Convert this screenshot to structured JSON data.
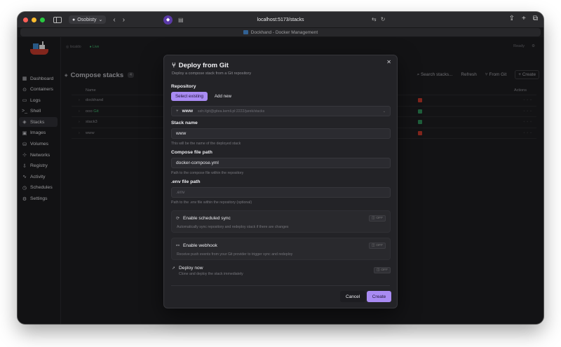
{
  "browser": {
    "profile": "Osobisty",
    "url": "localhost:5173/stacks",
    "tab_title": "Dockhand - Docker Management"
  },
  "sidebar": {
    "items": [
      {
        "label": "Dashboard",
        "icon": "dashboard-icon"
      },
      {
        "label": "Containers",
        "icon": "containers-icon"
      },
      {
        "label": "Logs",
        "icon": "logs-icon"
      },
      {
        "label": "Shell",
        "icon": "shell-icon"
      },
      {
        "label": "Stacks",
        "icon": "stacks-icon",
        "active": true
      },
      {
        "label": "Images",
        "icon": "images-icon"
      },
      {
        "label": "Volumes",
        "icon": "volumes-icon"
      },
      {
        "label": "Networks",
        "icon": "networks-icon"
      },
      {
        "label": "Registry",
        "icon": "registry-icon"
      },
      {
        "label": "Activity",
        "icon": "activity-icon"
      },
      {
        "label": "Schedules",
        "icon": "schedules-icon"
      },
      {
        "label": "Settings",
        "icon": "settings-icon"
      }
    ]
  },
  "statusbar": {
    "host": "localdo",
    "live": "Live",
    "ready": "Ready"
  },
  "page": {
    "title": "Compose stacks",
    "search_placeholder": "Search stacks...",
    "refresh": "Refresh",
    "from_git": "From Git",
    "create": "Create"
  },
  "table": {
    "headers": {
      "name": "Name",
      "actions": "Actions"
    },
    "rows": [
      {
        "name": "dockhand",
        "status_color": "#c0392b"
      },
      {
        "name": "ooo",
        "tag": "Git",
        "status_color": "#2e8b57"
      },
      {
        "name": "stack3",
        "status_color": "#2e8b57"
      },
      {
        "name": "www",
        "status_color": "#c0392b"
      }
    ]
  },
  "modal": {
    "title": "Deploy from Git",
    "subtitle": "Deploy a compose stack from a Git repository",
    "repository": {
      "label": "Repository",
      "tabs": [
        "Select existing",
        "Add new"
      ],
      "selected_name": "www",
      "selected_url": "ssh://git@gitea.kemli.pl:2222/jarek/stacks"
    },
    "stack_name": {
      "label": "Stack name",
      "value": "www",
      "help": "This will be the name of the deployed stack"
    },
    "compose_path": {
      "label": "Compose file path",
      "value": "docker-compose.yml",
      "help": "Path to the compose file within the repository"
    },
    "env_path": {
      "label": ".env file path",
      "placeholder": ".env",
      "help": "Path to the .env file within the repository (optional)"
    },
    "scheduled_sync": {
      "title": "Enable scheduled sync",
      "desc": "Automatically sync repository and redeploy stack if there are changes",
      "toggle": "OFF"
    },
    "webhook": {
      "title": "Enable webhook",
      "desc": "Receive push events from your Git provider to trigger sync and redeploy",
      "toggle": "OFF"
    },
    "deploy_now": {
      "title": "Deploy now",
      "desc": "Clone and deploy the stack immediately",
      "toggle": "OFF"
    },
    "cancel": "Cancel",
    "create": "Create"
  },
  "colors": {
    "accent": "#a98bf3",
    "live": "#3fae6a"
  }
}
